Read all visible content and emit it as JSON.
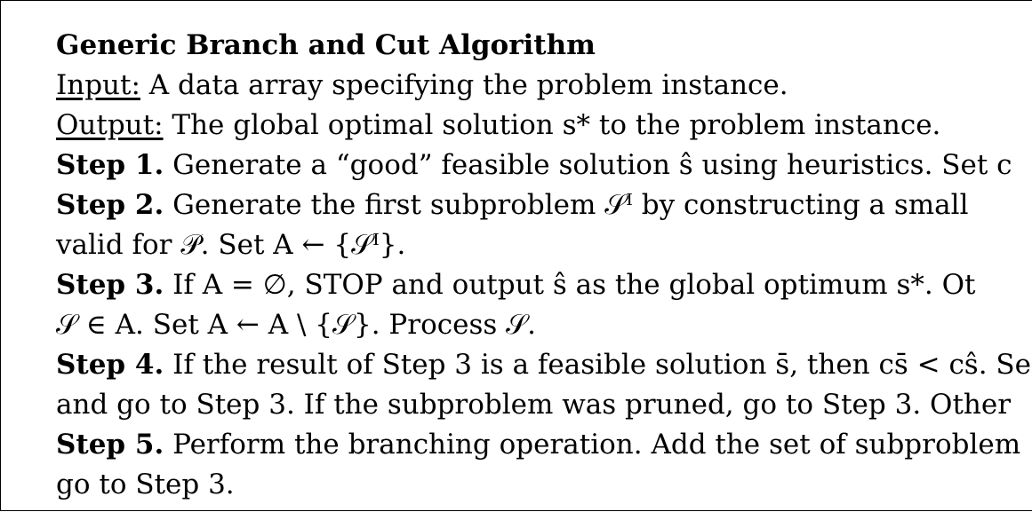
{
  "algorithm": {
    "title": "Generic Branch and Cut Algorithm",
    "input_label": "Input:",
    "input_text": " A data array specifying the problem instance.",
    "output_label": "Output:",
    "output_text": " The global optimal solution s* to the problem instance.",
    "steps": [
      {
        "label": "Step 1.",
        "lines": [
          " Generate a “good” feasible solution ŝ using heuristics. Set c"
        ]
      },
      {
        "label": "Step 2.",
        "lines": [
          " Generate the first subproblem 𝒮ᴵ by constructing a small",
          "valid for 𝒫. Set A ← {𝒮ᴵ}."
        ]
      },
      {
        "label": "Step 3.",
        "lines": [
          " If A = ∅, STOP and output ŝ as the global optimum s*. Ot",
          "𝒮 ∈ A. Set A ← A \\ {𝒮}. Process 𝒮."
        ]
      },
      {
        "label": "Step 4.",
        "lines": [
          " If the result of Step 3 is a feasible solution s̄, then cs̄ < cŝ. Se",
          "and go to Step 3. If the subproblem was pruned, go to Step 3. Other"
        ]
      },
      {
        "label": "Step 5.",
        "lines": [
          " Perform the branching operation. Add the set of subproblem",
          "go to Step 3."
        ]
      }
    ]
  }
}
